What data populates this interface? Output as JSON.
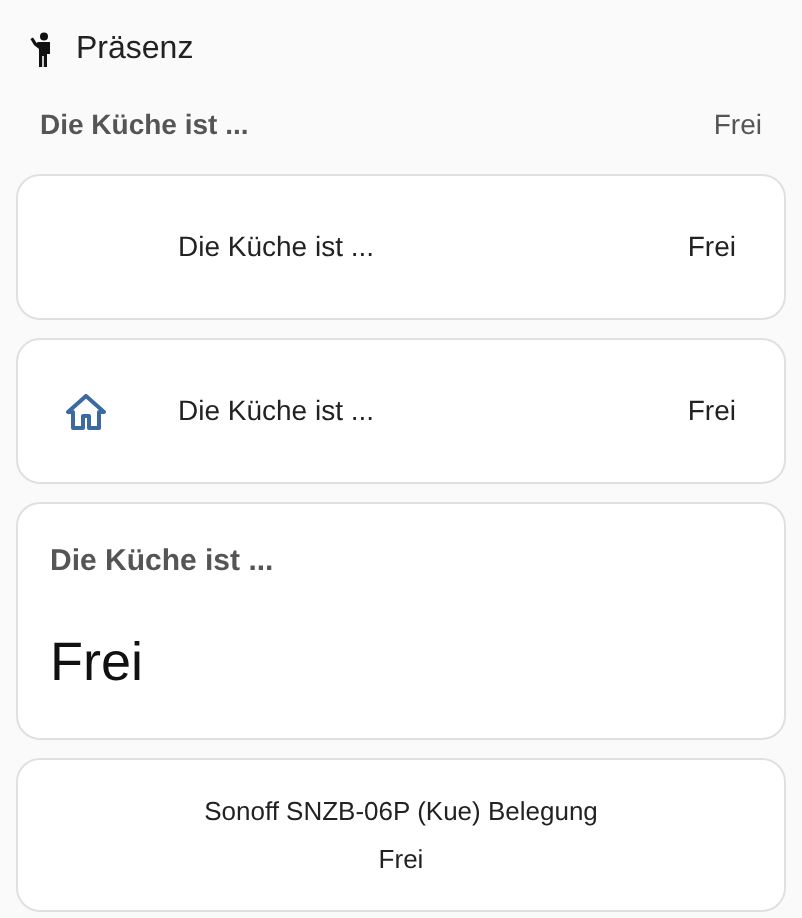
{
  "header": {
    "title": "Präsenz"
  },
  "items": [
    {
      "kind": "plain",
      "name": "Die Küche ist ...",
      "state": "Frei"
    },
    {
      "kind": "row",
      "icon": false,
      "name": "Die Küche ist ...",
      "state": "Frei"
    },
    {
      "kind": "row",
      "icon": true,
      "name": "Die Küche ist ...",
      "state": "Frei"
    },
    {
      "kind": "tile",
      "name": "Die Küche ist ...",
      "state": "Frei"
    },
    {
      "kind": "button",
      "name": "Sonoff SNZB-06P (Kue) Belegung",
      "state": "Frei"
    }
  ]
}
